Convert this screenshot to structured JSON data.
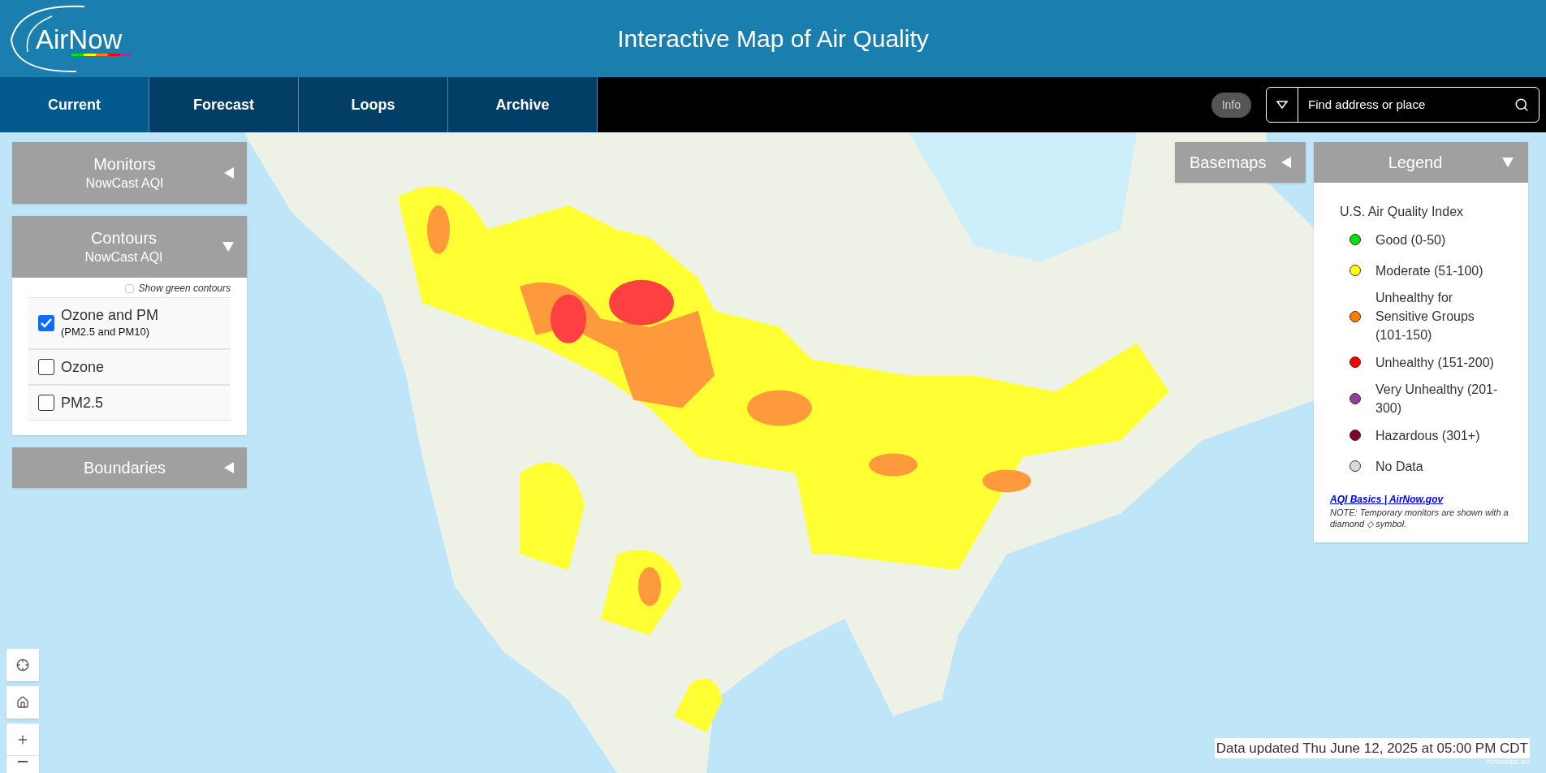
{
  "header": {
    "logo": "AirNow",
    "title": "Interactive Map of Air Quality"
  },
  "tabs": [
    {
      "label": "Current",
      "selected": true
    },
    {
      "label": "Forecast",
      "selected": false
    },
    {
      "label": "Loops",
      "selected": false
    },
    {
      "label": "Archive",
      "selected": false
    }
  ],
  "info_button": "Info",
  "search": {
    "placeholder": "Find address or place"
  },
  "left_panels": {
    "monitors": {
      "title": "Monitors",
      "subtitle": "NowCast AQI",
      "expanded": false
    },
    "contours": {
      "title": "Contours",
      "subtitle": "NowCast AQI",
      "expanded": true,
      "show_green": {
        "label": "Show green contours",
        "checked": false
      },
      "options": [
        {
          "label": "Ozone and PM",
          "sublabel": "(PM2.5 and PM10)",
          "checked": true
        },
        {
          "label": "Ozone",
          "checked": false
        },
        {
          "label": "PM2.5",
          "checked": false
        }
      ]
    },
    "boundaries": {
      "title": "Boundaries",
      "expanded": false
    }
  },
  "basemaps": {
    "title": "Basemaps",
    "expanded": false
  },
  "legend": {
    "title": "Legend",
    "expanded": true,
    "heading": "U.S. Air Quality Index",
    "items": [
      {
        "label": "Good (0-50)",
        "color": "#00e400"
      },
      {
        "label": "Moderate (51-100)",
        "color": "#ffff00"
      },
      {
        "label": "Unhealthy for Sensitive Groups (101-150)",
        "color": "#ff7e00"
      },
      {
        "label": "Unhealthy (151-200)",
        "color": "#ff0000"
      },
      {
        "label": "Very Unhealthy (201-300)",
        "color": "#8f3f97"
      },
      {
        "label": "Hazardous (301+)",
        "color": "#7e0023"
      },
      {
        "label": "No Data",
        "color": "#d9d9d9"
      }
    ],
    "link": "AQI Basics | AirNow.gov",
    "note": "NOTE: Temporary monitors are shown with a diamond ◇ symbol."
  },
  "status": "Data updated Thu June 12, 2025 at 05:00 PM CDT",
  "attribution": "POWERED BY"
}
